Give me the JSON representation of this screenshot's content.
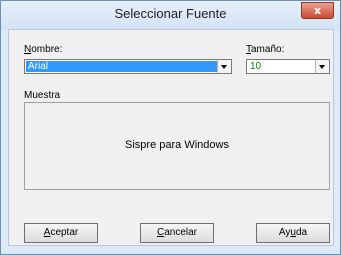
{
  "window": {
    "title": "Seleccionar Fuente",
    "close_glyph": "x"
  },
  "font_name": {
    "label": "Nombre:",
    "value": "Arial",
    "label_access_key": "N",
    "label_rest": "ombre:"
  },
  "font_size": {
    "label": "Tamaño:",
    "value": "10",
    "label_access_key": "T",
    "label_rest": "amaño:"
  },
  "sample": {
    "label": "Muestra",
    "text": "Sispre para Windows"
  },
  "buttons": {
    "ok": {
      "label": "Aceptar",
      "access_key": "A",
      "rest": "ceptar"
    },
    "cancel": {
      "label": "Cancelar",
      "access_key": "C",
      "rest": "ancelar"
    },
    "help": {
      "label": "Ayuda",
      "pre": "Ay",
      "access_key": "u",
      "rest": "da"
    }
  },
  "colors": {
    "selection": "#3399ff",
    "size_value": "#0a7a0a"
  }
}
